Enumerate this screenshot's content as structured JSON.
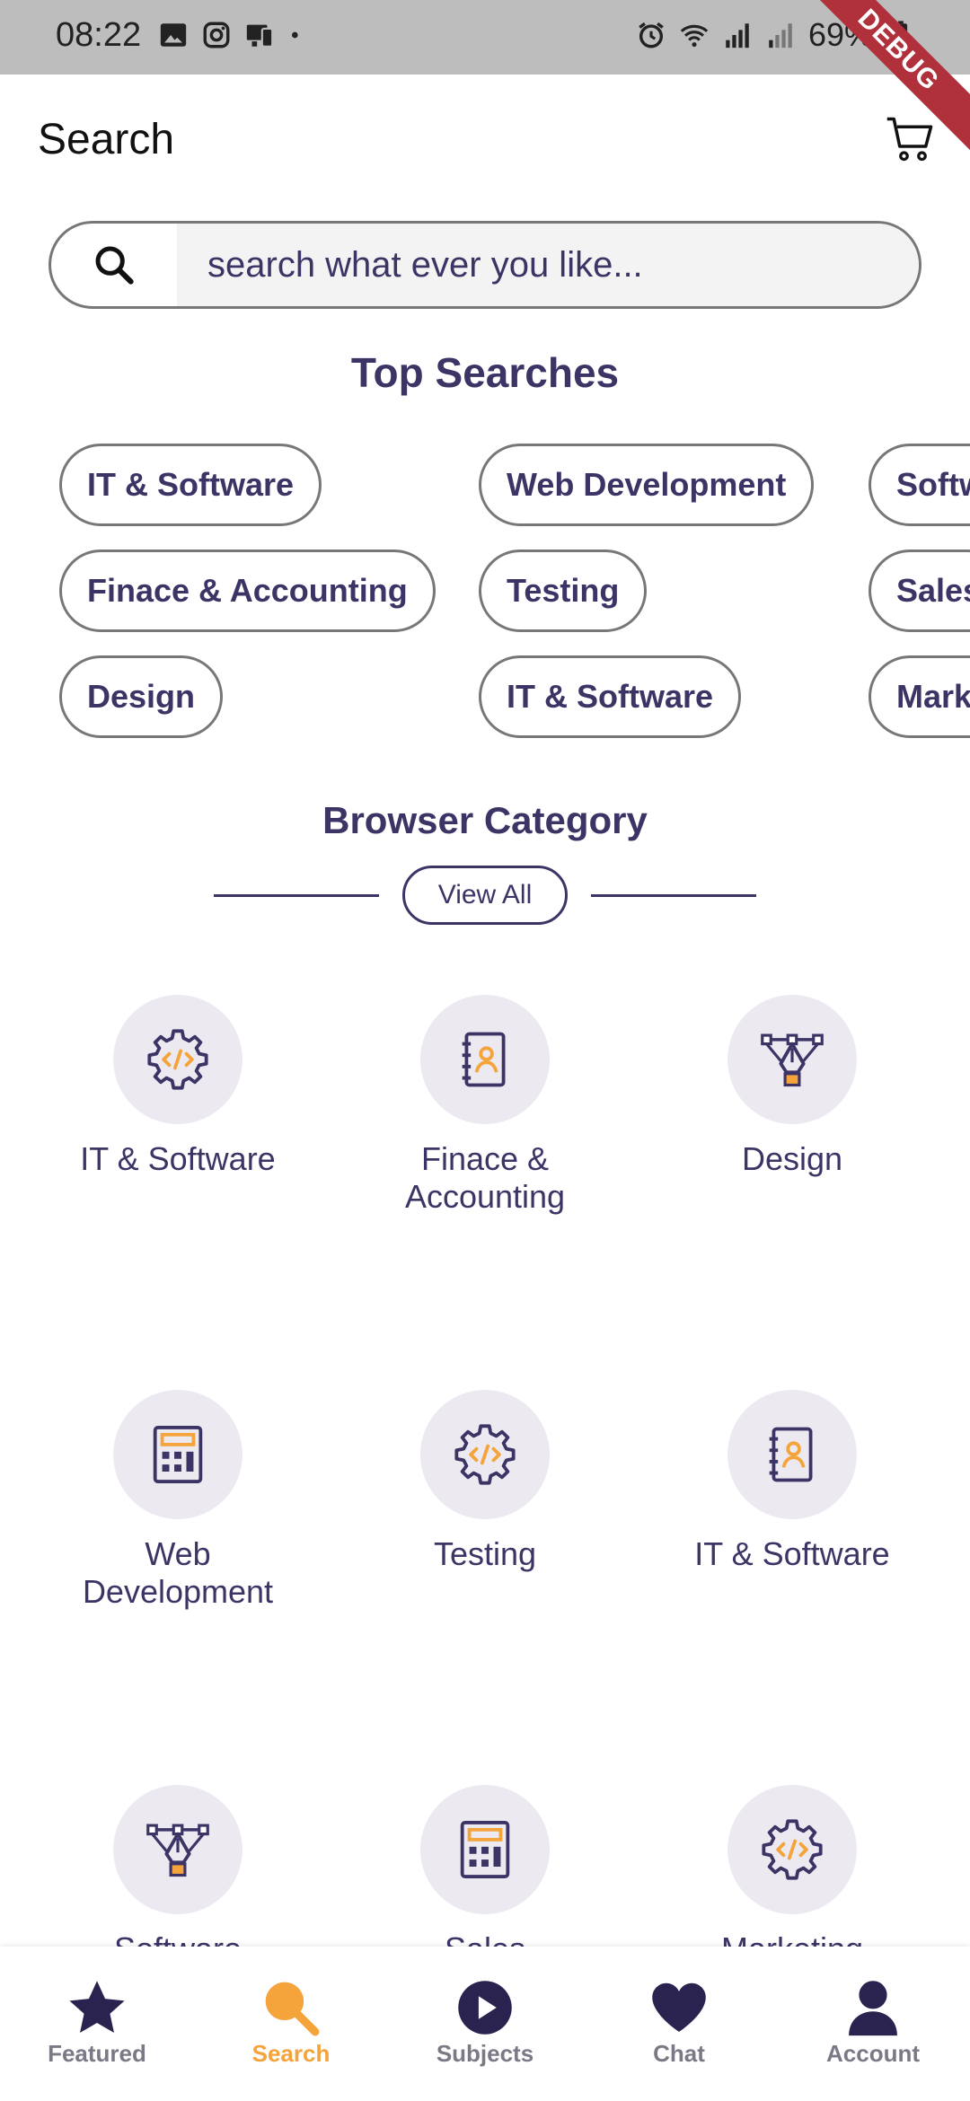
{
  "status_bar": {
    "time": "08:22",
    "battery": "69%",
    "debug_label": "DEBUG"
  },
  "header": {
    "title": "Search"
  },
  "search": {
    "placeholder": "search what ever you like..."
  },
  "top_searches": {
    "title": "Top Searches",
    "chips": [
      "IT & Software",
      "Finace & Accounting",
      "Design",
      "Web Development",
      "Testing",
      "IT & Software",
      "Software",
      "Sales",
      "Marketing"
    ]
  },
  "browse": {
    "title": "Browser Category",
    "view_all_label": "View All",
    "categories": [
      {
        "label": "IT & Software",
        "icon": "gear-code-icon"
      },
      {
        "label": "Finace & Accounting",
        "icon": "contact-book-icon"
      },
      {
        "label": "Design",
        "icon": "pen-tool-icon"
      },
      {
        "label": "Web Development",
        "icon": "calculator-icon"
      },
      {
        "label": "Testing",
        "icon": "gear-code-icon"
      },
      {
        "label": "IT & Software",
        "icon": "contact-book-icon"
      },
      {
        "label": "Software",
        "icon": "pen-tool-icon"
      },
      {
        "label": "Sales",
        "icon": "calculator-icon"
      },
      {
        "label": "Marketing",
        "icon": "gear-code-icon"
      }
    ]
  },
  "bottom_nav": {
    "items": [
      {
        "label": "Featured",
        "icon": "star-icon"
      },
      {
        "label": "Search",
        "icon": "search-icon"
      },
      {
        "label": "Subjects",
        "icon": "play-icon"
      },
      {
        "label": "Chat",
        "icon": "heart-icon"
      },
      {
        "label": "Account",
        "icon": "person-icon"
      }
    ],
    "active": "Search"
  },
  "colors": {
    "primary": "#3d3466",
    "accent": "#f5a33b",
    "circle_bg": "#ece9f1"
  }
}
